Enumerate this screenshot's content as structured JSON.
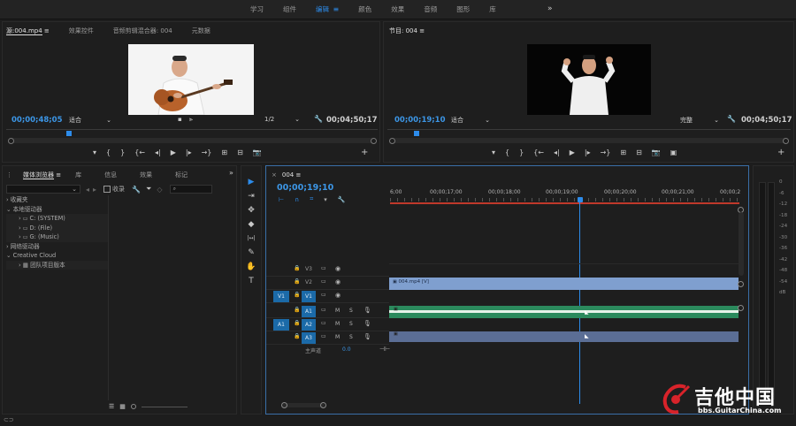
{
  "workspaces": {
    "tabs": [
      "学习",
      "组件",
      "编辑",
      "颜色",
      "效果",
      "音频",
      "图形",
      "库"
    ],
    "active_tab": "编辑",
    "more": "»"
  },
  "source_panel": {
    "tabs": [
      "源:004.mp4",
      "效果控件",
      "音频剪辑混合器: 004",
      "元数据"
    ],
    "tab_menu": "≡",
    "timecode_left": "00;00;48;05",
    "fit_label": "适合",
    "resolution": "1/2",
    "timecode_right": "00;04;50;17",
    "controls": [
      "▾",
      "{",
      "}",
      "{←",
      "◂|",
      "▶",
      "|▸",
      "→}",
      "⊞",
      "⊟",
      "📷",
      "+"
    ]
  },
  "program_panel": {
    "tab": "节目: 004",
    "tab_menu": "≡",
    "timecode_left": "00;00;19;10",
    "fit_label": "适合",
    "resolution": "完整",
    "timecode_right": "00;04;50;17",
    "controls": [
      "▾",
      "{",
      "}",
      "{←",
      "◂|",
      "▶",
      "|▸",
      "→}",
      "⊞",
      "⊟",
      "📷",
      "▣",
      "+"
    ]
  },
  "media_browser": {
    "tabs": [
      "媒体浏览器",
      "库",
      "信息",
      "效果",
      "标记"
    ],
    "tab_menu": "≡",
    "more": "»",
    "ingest_label": "收录",
    "tree": [
      {
        "label": "收藏夹",
        "level": 0,
        "arrow": "›"
      },
      {
        "label": "本地驱动器",
        "level": 0,
        "arrow": "⌄"
      },
      {
        "label": "C: (SYSTEM)",
        "level": 1,
        "arrow": "›"
      },
      {
        "label": "D: (File)",
        "level": 1,
        "arrow": "›"
      },
      {
        "label": "G: (Music)",
        "level": 1,
        "arrow": "›"
      },
      {
        "label": "网络驱动器",
        "level": 0,
        "arrow": "›"
      },
      {
        "label": "Creative Cloud",
        "level": 0,
        "arrow": "⌄"
      },
      {
        "label": "团队项目版本",
        "level": 1,
        "arrow": "›"
      }
    ]
  },
  "tools": [
    "▶",
    "⇥",
    "✥",
    "◆",
    "|↔|",
    "✎",
    "✋",
    "T"
  ],
  "timeline": {
    "tab": "004",
    "tab_menu": "≡",
    "close": "×",
    "timecode": "00;00;19;10",
    "ruler_labels": [
      "6;00",
      "00;00;17;00",
      "00;00;18;00",
      "00;00;19;00",
      "00;00;20;00",
      "00;00;21;00",
      "00;00;2"
    ],
    "video_tracks": [
      "V3",
      "V2",
      "V1"
    ],
    "audio_tracks": [
      "A1",
      "A2",
      "A3"
    ],
    "source_v": "V1",
    "source_a": "A1",
    "master_label": "主声道",
    "master_value": "0.0",
    "clip_v1_label": "004.mp4 [V]",
    "m_label": "M",
    "s_label": "S"
  },
  "audio_meter": {
    "ticks": [
      "0",
      "-6",
      "-12",
      "-18",
      "-24",
      "-30",
      "-36",
      "-42",
      "-48",
      "-54",
      "dB"
    ]
  },
  "watermark": {
    "title": "吉他中国",
    "url": "bbs.GuitarChina.com"
  },
  "colors": {
    "accent": "#2d8ceb",
    "timecode": "#3c96e6",
    "video_clip": "#7f9fcf",
    "audio_clip_a1": "#2b8a5d",
    "audio_clip_a2": "#5b6e95",
    "work_area": "#c0392b"
  }
}
